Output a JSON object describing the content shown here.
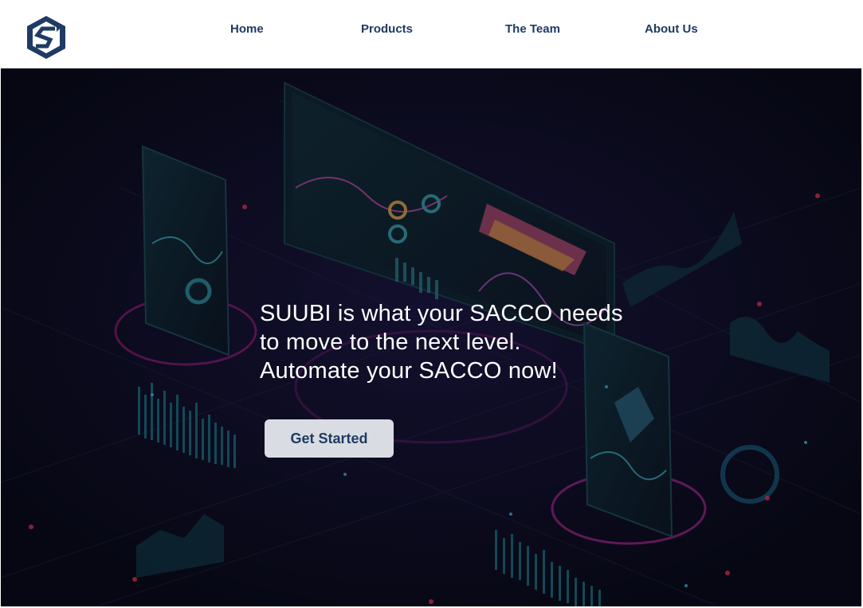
{
  "navbar": {
    "logo": "suubi-hexagon-logo",
    "links": [
      "Home",
      "Products",
      "The Team",
      "About Us"
    ]
  },
  "hero": {
    "headline_lines": [
      "SUUBI is what your SACCO needs",
      "to move to the next level.",
      "Automate your SACCO now!"
    ],
    "cta_label": "Get Started"
  },
  "colors": {
    "brand_navy": "#1f3b63",
    "hero_bg": "#0b0c1d",
    "cta_bg": "#d9dde3",
    "glow_magenta": "#b01f8a",
    "glow_teal": "#1e8c98"
  }
}
